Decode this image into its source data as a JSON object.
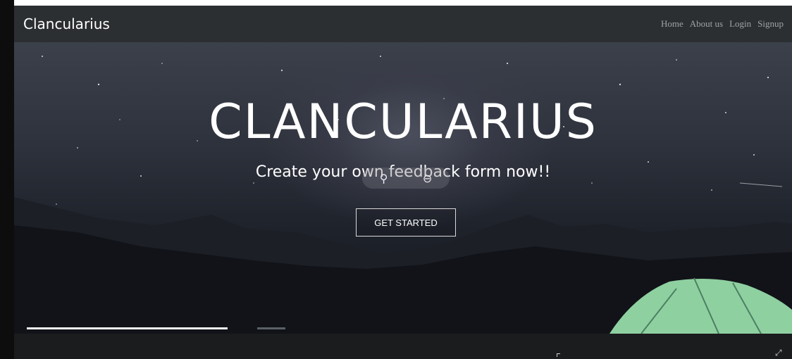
{
  "navbar": {
    "brand": "Clancularius",
    "links": [
      "Home",
      "About us",
      "Login",
      "Signup"
    ]
  },
  "hero": {
    "title": "CLANCULARIUS",
    "subtitle": "Create your own feedback form now!!",
    "cta_label": "GET STARTED"
  },
  "overlay": {
    "left_icon": "pin-icon",
    "right_icon": "minus-circle-icon"
  },
  "progress": {
    "first": 1.0,
    "second": 0.15
  },
  "colors": {
    "navbar_bg": "#2c2f31",
    "nav_link": "#9da3a7",
    "tent": "#8fd0a1"
  }
}
